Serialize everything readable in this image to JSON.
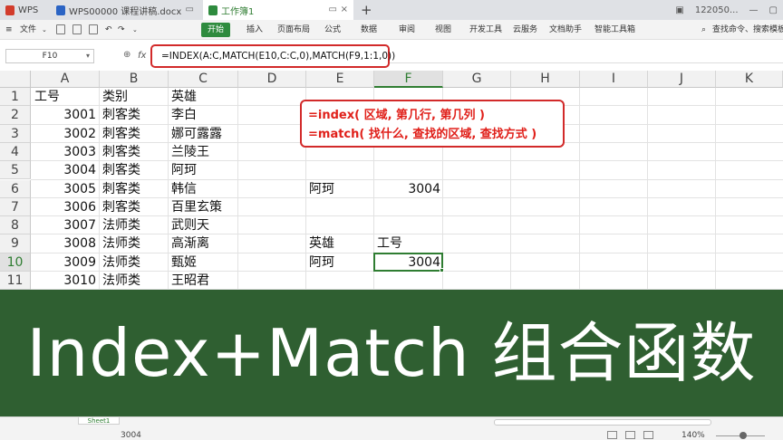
{
  "titlebar": {
    "tabs": [
      {
        "label": "WPS",
        "icon": "wps-logo-icon",
        "color": "#d23c2c",
        "active": false
      },
      {
        "label": "WPS00000 课程讲稿.docx",
        "icon": "word-doc-icon",
        "color": "#2b64c4",
        "active": false
      },
      {
        "label": "工作簿1",
        "icon": "spreadsheet-icon",
        "color": "#2e8b3e",
        "active": true
      }
    ],
    "account": "122050..."
  },
  "menubar": {
    "file_label": "文件",
    "start_label": "开始",
    "items": [
      "插入",
      "页面布局",
      "公式",
      "数据",
      "审阅",
      "视图",
      "开发工具",
      "云服务",
      "文档助手",
      "智能工具箱"
    ],
    "search_label": "查找命令、搜索模板"
  },
  "formula_bar": {
    "name_box": "F10",
    "fx": "fx",
    "formula": "=INDEX(A:C,MATCH(E10,C:C,0),MATCH(F9,1:1,0))"
  },
  "sheet": {
    "columns": [
      "A",
      "B",
      "C",
      "D",
      "E",
      "F",
      "G",
      "H",
      "I",
      "J",
      "K"
    ],
    "selected_column": "F",
    "rows": [
      "1",
      "2",
      "3",
      "4",
      "5",
      "6",
      "7",
      "8",
      "9",
      "10",
      "11"
    ],
    "selected_row": "10",
    "table": [
      {
        "id": "工号",
        "category": "类别",
        "hero": "英雄"
      },
      {
        "id": "3001",
        "category": "刺客类",
        "hero": "李白"
      },
      {
        "id": "3002",
        "category": "刺客类",
        "hero": "娜可露露"
      },
      {
        "id": "3003",
        "category": "刺客类",
        "hero": "兰陵王"
      },
      {
        "id": "3004",
        "category": "刺客类",
        "hero": "阿珂"
      },
      {
        "id": "3005",
        "category": "刺客类",
        "hero": "韩信"
      },
      {
        "id": "3006",
        "category": "刺客类",
        "hero": "百里玄策"
      },
      {
        "id": "3007",
        "category": "法师类",
        "hero": "武则天"
      },
      {
        "id": "3008",
        "category": "法师类",
        "hero": "高渐离"
      },
      {
        "id": "3009",
        "category": "法师类",
        "hero": "甄姬"
      },
      {
        "id": "3010",
        "category": "法师类",
        "hero": "王昭君"
      }
    ],
    "e6": "阿珂",
    "f6": "3004",
    "e9": "英雄",
    "f9": "工号",
    "e10": "阿珂",
    "f10": "3004",
    "note_line1": "=index( 区域, 第几行, 第几列 )",
    "note_line2": "=match( 找什么, 查找的区域, 查找方式 )"
  },
  "banner": {
    "title": "Index+Match 组合函数",
    "color": "#2f5f31"
  },
  "status": {
    "sheet_tab": "Sheet1",
    "value": "3004",
    "zoom": "140%"
  }
}
